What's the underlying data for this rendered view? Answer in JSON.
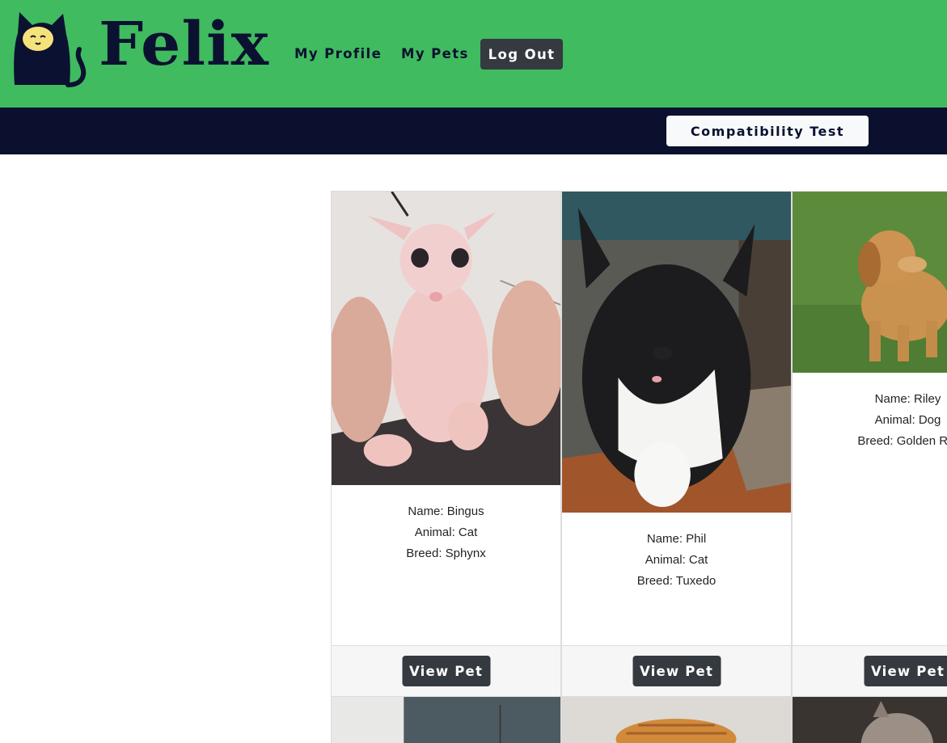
{
  "header": {
    "brand": "Felix",
    "logo_icon": "cat-logo-icon",
    "nav": {
      "my_profile": "My Profile",
      "my_pets": "My Pets",
      "log_out": "Log Out"
    },
    "colors": {
      "primary_bar": "#40bb5f",
      "secondary_bar": "#0a102e",
      "dark_button": "#343a40"
    }
  },
  "subheader": {
    "compatibility_test": "Compatibility Test"
  },
  "pets": [
    {
      "name": "Name: Bingus",
      "animal": "Animal: Cat",
      "breed": "Breed: Sphynx",
      "button": "View Pet"
    },
    {
      "name": "Name: Phil",
      "animal": "Animal: Cat",
      "breed": "Breed: Tuxedo",
      "button": "View Pet"
    },
    {
      "name": "Name: Riley",
      "animal": "Animal: Dog",
      "breed": "Breed: Golden Ret",
      "button": "View Pet"
    }
  ]
}
